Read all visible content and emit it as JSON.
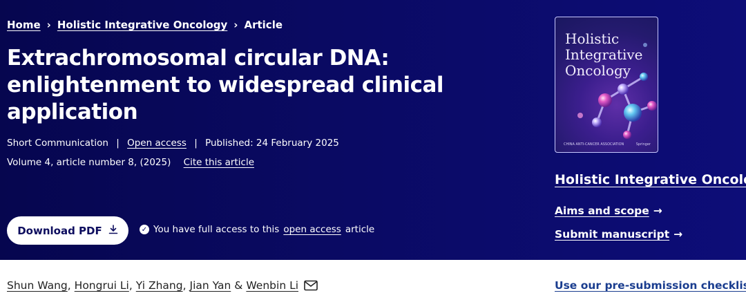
{
  "breadcrumb": {
    "items": [
      "Home",
      "Holistic Integrative Oncology",
      "Article"
    ]
  },
  "article": {
    "title": "Extrachromosomal circular DNA: enlightenment to widespread clinical application",
    "type": "Short Communication",
    "access": "Open access",
    "published": "Published: 24 February 2025",
    "volume": "Volume 4, article number 8, (2025)",
    "cite": "Cite this article"
  },
  "download": {
    "label": "Download PDF"
  },
  "access_notice": {
    "prefix": "You have full access to this",
    "link": "open access",
    "suffix": "article"
  },
  "journal": {
    "cover_lines": [
      "Holistic",
      "Integrative",
      "Oncology"
    ],
    "cover_foot_left": "CHINA ANTI-CANCER ASSOCIATION",
    "cover_foot_right": "Springer",
    "name": "Holistic Integrative Oncology",
    "aims": "Aims and scope",
    "submit": "Submit manuscript"
  },
  "authors": [
    "Shun Wang",
    "Hongrui Li",
    "Yi Zhang",
    "Jian Yan",
    "Wenbin Li"
  ],
  "checklist": "Use our pre-submission checklist",
  "icons": {
    "download": "download-icon",
    "check": "check-circle-icon",
    "arrow": "arrow-right-icon",
    "mail": "mail-icon"
  }
}
